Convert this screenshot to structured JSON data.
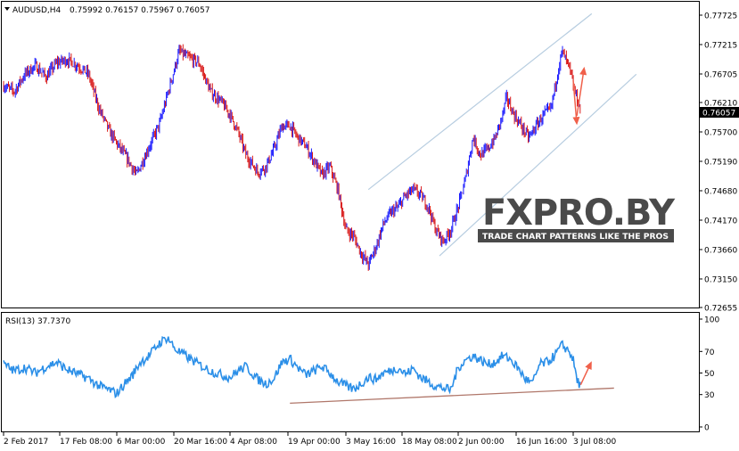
{
  "chart_data": [
    {
      "type": "candlestick",
      "symbol_label": "AUDUSD,H4",
      "ohlc_label": "0.75992 0.76157 0.75967 0.76057",
      "current_price": "0.76057",
      "ylim": [
        0.72655,
        0.77725
      ],
      "y_ticks": [
        "0.77725",
        "0.77215",
        "0.76705",
        "0.76210",
        "0.75700",
        "0.75190",
        "0.74680",
        "0.74170",
        "0.73660",
        "0.73150",
        "0.72655"
      ],
      "x_tick_labels": [
        "2 Feb 2017",
        "17 Feb 08:00",
        "6 Mar 00:00",
        "20 Mar 16:00",
        "4 Apr 08:00",
        "19 Apr 00:00",
        "3 May 16:00",
        "18 May 08:00",
        "2 Jun 00:00",
        "16 Jun 16:00",
        "3 Jul 08:00"
      ],
      "x_key_dates": [
        "2017-02-02",
        "2017-03-06",
        "2017-04-04",
        "2017-05-03",
        "2017-06-02",
        "2017-07-03"
      ],
      "close_path": [
        [
          "2017-02-02",
          0.765
        ],
        [
          "2017-02-05",
          0.764
        ],
        [
          "2017-02-08",
          0.767
        ],
        [
          "2017-02-11",
          0.7685
        ],
        [
          "2017-02-14",
          0.7665
        ],
        [
          "2017-02-17",
          0.769
        ],
        [
          "2017-02-20",
          0.7695
        ],
        [
          "2017-02-23",
          0.7685
        ],
        [
          "2017-02-26",
          0.767
        ],
        [
          "2017-03-01",
          0.761
        ],
        [
          "2017-03-04",
          0.757
        ],
        [
          "2017-03-06",
          0.755
        ],
        [
          "2017-03-09",
          0.752
        ],
        [
          "2017-03-11",
          0.7495
        ],
        [
          "2017-03-14",
          0.754
        ],
        [
          "2017-03-17",
          0.7585
        ],
        [
          "2017-03-20",
          0.766
        ],
        [
          "2017-03-22",
          0.771
        ],
        [
          "2017-03-24",
          0.77
        ],
        [
          "2017-03-27",
          0.769
        ],
        [
          "2017-03-30",
          0.764
        ],
        [
          "2017-04-02",
          0.762
        ],
        [
          "2017-04-04",
          0.76
        ],
        [
          "2017-04-06",
          0.757
        ],
        [
          "2017-04-08",
          0.753
        ],
        [
          "2017-04-11",
          0.75
        ],
        [
          "2017-04-13",
          0.751
        ],
        [
          "2017-04-15",
          0.754
        ],
        [
          "2017-04-17",
          0.758
        ],
        [
          "2017-04-19",
          0.758
        ],
        [
          "2017-04-21",
          0.756
        ],
        [
          "2017-04-23",
          0.7545
        ],
        [
          "2017-04-25",
          0.752
        ],
        [
          "2017-04-27",
          0.7495
        ],
        [
          "2017-04-29",
          0.751
        ],
        [
          "2017-05-01",
          0.747
        ],
        [
          "2017-05-03",
          0.74
        ],
        [
          "2017-05-05",
          0.739
        ],
        [
          "2017-05-07",
          0.736
        ],
        [
          "2017-05-09",
          0.734
        ],
        [
          "2017-05-11",
          0.737
        ],
        [
          "2017-05-13",
          0.741
        ],
        [
          "2017-05-15",
          0.743
        ],
        [
          "2017-05-17",
          0.744
        ],
        [
          "2017-05-19",
          0.746
        ],
        [
          "2017-05-21",
          0.747
        ],
        [
          "2017-05-23",
          0.746
        ],
        [
          "2017-05-25",
          0.744
        ],
        [
          "2017-05-27",
          0.74
        ],
        [
          "2017-05-29",
          0.738
        ],
        [
          "2017-05-31",
          0.74
        ],
        [
          "2017-06-02",
          0.744
        ],
        [
          "2017-06-04",
          0.749
        ],
        [
          "2017-06-06",
          0.756
        ],
        [
          "2017-06-08",
          0.753
        ],
        [
          "2017-06-10",
          0.754
        ],
        [
          "2017-06-12",
          0.756
        ],
        [
          "2017-06-14",
          0.76
        ],
        [
          "2017-06-15",
          0.763
        ],
        [
          "2017-06-17",
          0.76
        ],
        [
          "2017-06-19",
          0.758
        ],
        [
          "2017-06-21",
          0.756
        ],
        [
          "2017-06-23",
          0.758
        ],
        [
          "2017-06-25",
          0.76
        ],
        [
          "2017-06-27",
          0.761
        ],
        [
          "2017-06-29",
          0.768
        ],
        [
          "2017-06-30",
          0.771
        ],
        [
          "2017-07-02",
          0.768
        ],
        [
          "2017-07-03",
          0.765
        ],
        [
          "2017-07-05",
          0.7606
        ]
      ],
      "upper_channel": [
        [
          "2017-05-09",
          0.747
        ],
        [
          "2017-07-08",
          0.7775
        ]
      ],
      "lower_channel": [
        [
          "2017-05-28",
          0.7355
        ],
        [
          "2017-07-20",
          0.767
        ]
      ],
      "arrows": [
        {
          "from": [
            "2017-07-03",
            0.766
          ],
          "to": [
            "2017-07-04",
            0.7582
          ]
        },
        {
          "from": [
            "2017-07-04",
            0.7598
          ],
          "to": [
            "2017-07-06",
            0.7683
          ]
        }
      ]
    },
    {
      "type": "line",
      "label": "RSI(13) 37.7370",
      "ylim": [
        0,
        100
      ],
      "y_ticks": [
        "100",
        "70",
        "50",
        "30",
        "0"
      ],
      "path": [
        [
          "2017-02-02",
          58
        ],
        [
          "2017-02-05",
          52
        ],
        [
          "2017-02-08",
          55
        ],
        [
          "2017-02-11",
          50
        ],
        [
          "2017-02-14",
          56
        ],
        [
          "2017-02-17",
          60
        ],
        [
          "2017-02-20",
          53
        ],
        [
          "2017-02-23",
          49
        ],
        [
          "2017-02-26",
          45
        ],
        [
          "2017-03-01",
          38
        ],
        [
          "2017-03-04",
          34
        ],
        [
          "2017-03-06",
          31
        ],
        [
          "2017-03-08",
          40
        ],
        [
          "2017-03-10",
          48
        ],
        [
          "2017-03-12",
          60
        ],
        [
          "2017-03-14",
          65
        ],
        [
          "2017-03-17",
          78
        ],
        [
          "2017-03-19",
          83
        ],
        [
          "2017-03-21",
          72
        ],
        [
          "2017-03-24",
          65
        ],
        [
          "2017-03-27",
          58
        ],
        [
          "2017-03-30",
          52
        ],
        [
          "2017-04-02",
          48
        ],
        [
          "2017-04-04",
          46
        ],
        [
          "2017-04-06",
          52
        ],
        [
          "2017-04-08",
          56
        ],
        [
          "2017-04-11",
          44
        ],
        [
          "2017-04-13",
          40
        ],
        [
          "2017-04-15",
          45
        ],
        [
          "2017-04-17",
          60
        ],
        [
          "2017-04-19",
          63
        ],
        [
          "2017-04-21",
          55
        ],
        [
          "2017-04-23",
          48
        ],
        [
          "2017-04-25",
          52
        ],
        [
          "2017-04-27",
          56
        ],
        [
          "2017-04-29",
          50
        ],
        [
          "2017-05-01",
          42
        ],
        [
          "2017-05-03",
          38
        ],
        [
          "2017-05-05",
          35
        ],
        [
          "2017-05-07",
          40
        ],
        [
          "2017-05-09",
          46
        ],
        [
          "2017-05-11",
          44
        ],
        [
          "2017-05-13",
          50
        ],
        [
          "2017-05-15",
          52
        ],
        [
          "2017-05-17",
          55
        ],
        [
          "2017-05-19",
          49
        ],
        [
          "2017-05-21",
          54
        ],
        [
          "2017-05-23",
          46
        ],
        [
          "2017-05-25",
          42
        ],
        [
          "2017-05-27",
          38
        ],
        [
          "2017-05-29",
          36
        ],
        [
          "2017-05-31",
          34
        ],
        [
          "2017-06-02",
          55
        ],
        [
          "2017-06-04",
          62
        ],
        [
          "2017-06-06",
          66
        ],
        [
          "2017-06-08",
          62
        ],
        [
          "2017-06-10",
          58
        ],
        [
          "2017-06-12",
          60
        ],
        [
          "2017-06-14",
          66
        ],
        [
          "2017-06-16",
          63
        ],
        [
          "2017-06-18",
          55
        ],
        [
          "2017-06-20",
          45
        ],
        [
          "2017-06-22",
          40
        ],
        [
          "2017-06-24",
          58
        ],
        [
          "2017-06-26",
          60
        ],
        [
          "2017-06-28",
          66
        ],
        [
          "2017-06-30",
          76
        ],
        [
          "2017-07-02",
          70
        ],
        [
          "2017-07-03",
          62
        ],
        [
          "2017-07-04",
          44
        ],
        [
          "2017-07-05",
          38
        ]
      ],
      "trendline": [
        [
          "2017-04-19",
          22
        ],
        [
          "2017-07-14",
          36
        ]
      ],
      "arrow": {
        "from": [
          "2017-07-05",
          39
        ],
        "to": [
          "2017-07-08",
          61
        ]
      }
    }
  ],
  "watermark": {
    "text_main": "FXPRO.BY",
    "text_tagline": "TRADE CHART PATTERNS LIKE THE PROS"
  },
  "colors": {
    "bull": "#1a1aff",
    "bear": "#d91a1a",
    "rsi": "#2b8fe8",
    "channel": "#b7cde0",
    "arrow": "#f0604a",
    "rsi_trend": "#b0776a",
    "current_label_bg": "#000000",
    "watermark_dark": "#4a4a4a"
  }
}
